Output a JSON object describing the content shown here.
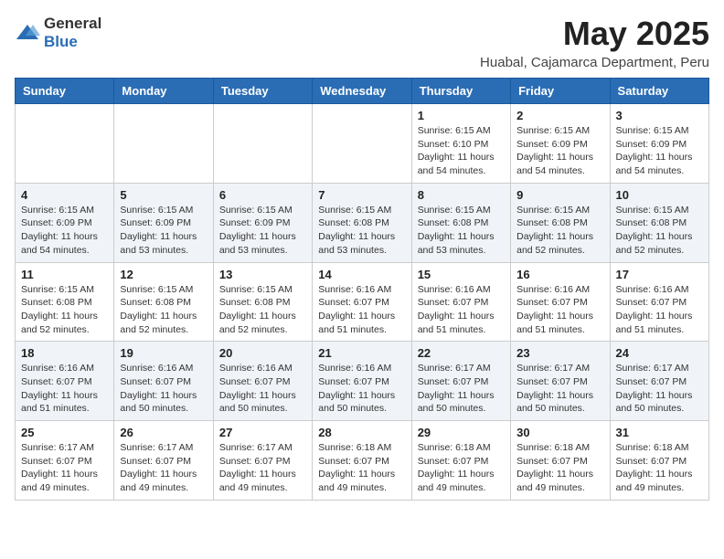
{
  "logo": {
    "text_general": "General",
    "text_blue": "Blue"
  },
  "header": {
    "month_title": "May 2025",
    "subtitle": "Huabal, Cajamarca Department, Peru"
  },
  "weekdays": [
    "Sunday",
    "Monday",
    "Tuesday",
    "Wednesday",
    "Thursday",
    "Friday",
    "Saturday"
  ],
  "weeks": [
    [
      {
        "day": "",
        "info": ""
      },
      {
        "day": "",
        "info": ""
      },
      {
        "day": "",
        "info": ""
      },
      {
        "day": "",
        "info": ""
      },
      {
        "day": "1",
        "info": "Sunrise: 6:15 AM\nSunset: 6:10 PM\nDaylight: 11 hours and 54 minutes."
      },
      {
        "day": "2",
        "info": "Sunrise: 6:15 AM\nSunset: 6:09 PM\nDaylight: 11 hours and 54 minutes."
      },
      {
        "day": "3",
        "info": "Sunrise: 6:15 AM\nSunset: 6:09 PM\nDaylight: 11 hours and 54 minutes."
      }
    ],
    [
      {
        "day": "4",
        "info": "Sunrise: 6:15 AM\nSunset: 6:09 PM\nDaylight: 11 hours and 54 minutes."
      },
      {
        "day": "5",
        "info": "Sunrise: 6:15 AM\nSunset: 6:09 PM\nDaylight: 11 hours and 53 minutes."
      },
      {
        "day": "6",
        "info": "Sunrise: 6:15 AM\nSunset: 6:09 PM\nDaylight: 11 hours and 53 minutes."
      },
      {
        "day": "7",
        "info": "Sunrise: 6:15 AM\nSunset: 6:08 PM\nDaylight: 11 hours and 53 minutes."
      },
      {
        "day": "8",
        "info": "Sunrise: 6:15 AM\nSunset: 6:08 PM\nDaylight: 11 hours and 53 minutes."
      },
      {
        "day": "9",
        "info": "Sunrise: 6:15 AM\nSunset: 6:08 PM\nDaylight: 11 hours and 52 minutes."
      },
      {
        "day": "10",
        "info": "Sunrise: 6:15 AM\nSunset: 6:08 PM\nDaylight: 11 hours and 52 minutes."
      }
    ],
    [
      {
        "day": "11",
        "info": "Sunrise: 6:15 AM\nSunset: 6:08 PM\nDaylight: 11 hours and 52 minutes."
      },
      {
        "day": "12",
        "info": "Sunrise: 6:15 AM\nSunset: 6:08 PM\nDaylight: 11 hours and 52 minutes."
      },
      {
        "day": "13",
        "info": "Sunrise: 6:15 AM\nSunset: 6:08 PM\nDaylight: 11 hours and 52 minutes."
      },
      {
        "day": "14",
        "info": "Sunrise: 6:16 AM\nSunset: 6:07 PM\nDaylight: 11 hours and 51 minutes."
      },
      {
        "day": "15",
        "info": "Sunrise: 6:16 AM\nSunset: 6:07 PM\nDaylight: 11 hours and 51 minutes."
      },
      {
        "day": "16",
        "info": "Sunrise: 6:16 AM\nSunset: 6:07 PM\nDaylight: 11 hours and 51 minutes."
      },
      {
        "day": "17",
        "info": "Sunrise: 6:16 AM\nSunset: 6:07 PM\nDaylight: 11 hours and 51 minutes."
      }
    ],
    [
      {
        "day": "18",
        "info": "Sunrise: 6:16 AM\nSunset: 6:07 PM\nDaylight: 11 hours and 51 minutes."
      },
      {
        "day": "19",
        "info": "Sunrise: 6:16 AM\nSunset: 6:07 PM\nDaylight: 11 hours and 50 minutes."
      },
      {
        "day": "20",
        "info": "Sunrise: 6:16 AM\nSunset: 6:07 PM\nDaylight: 11 hours and 50 minutes."
      },
      {
        "day": "21",
        "info": "Sunrise: 6:16 AM\nSunset: 6:07 PM\nDaylight: 11 hours and 50 minutes."
      },
      {
        "day": "22",
        "info": "Sunrise: 6:17 AM\nSunset: 6:07 PM\nDaylight: 11 hours and 50 minutes."
      },
      {
        "day": "23",
        "info": "Sunrise: 6:17 AM\nSunset: 6:07 PM\nDaylight: 11 hours and 50 minutes."
      },
      {
        "day": "24",
        "info": "Sunrise: 6:17 AM\nSunset: 6:07 PM\nDaylight: 11 hours and 50 minutes."
      }
    ],
    [
      {
        "day": "25",
        "info": "Sunrise: 6:17 AM\nSunset: 6:07 PM\nDaylight: 11 hours and 49 minutes."
      },
      {
        "day": "26",
        "info": "Sunrise: 6:17 AM\nSunset: 6:07 PM\nDaylight: 11 hours and 49 minutes."
      },
      {
        "day": "27",
        "info": "Sunrise: 6:17 AM\nSunset: 6:07 PM\nDaylight: 11 hours and 49 minutes."
      },
      {
        "day": "28",
        "info": "Sunrise: 6:18 AM\nSunset: 6:07 PM\nDaylight: 11 hours and 49 minutes."
      },
      {
        "day": "29",
        "info": "Sunrise: 6:18 AM\nSunset: 6:07 PM\nDaylight: 11 hours and 49 minutes."
      },
      {
        "day": "30",
        "info": "Sunrise: 6:18 AM\nSunset: 6:07 PM\nDaylight: 11 hours and 49 minutes."
      },
      {
        "day": "31",
        "info": "Sunrise: 6:18 AM\nSunset: 6:07 PM\nDaylight: 11 hours and 49 minutes."
      }
    ]
  ]
}
